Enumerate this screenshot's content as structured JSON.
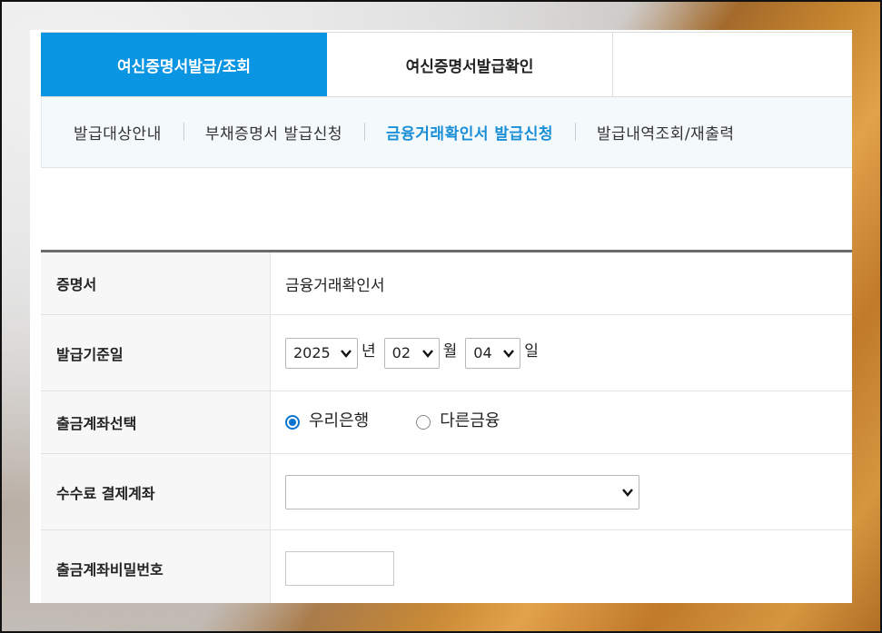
{
  "tabs": [
    {
      "label": "여신증명서발급/조회",
      "active": true
    },
    {
      "label": "여신증명서발급확인",
      "active": false
    }
  ],
  "subnav": [
    {
      "label": "발급대상안내"
    },
    {
      "label": "부채증명서 발급신청"
    },
    {
      "label": "금융거래확인서 발급신청",
      "active": true
    },
    {
      "label": "발급내역조회/재출력"
    }
  ],
  "form": {
    "certificate": {
      "label": "증명서",
      "value": "금융거래확인서"
    },
    "issue_date": {
      "label": "발급기준일",
      "year": "2025",
      "year_unit": "년",
      "month": "02",
      "month_unit": "월",
      "day": "04",
      "day_unit": "일"
    },
    "withdraw_account": {
      "label": "출금계좌선택",
      "options": [
        {
          "label": "우리은행",
          "selected": true
        },
        {
          "label": "다른금융",
          "selected": false
        }
      ]
    },
    "fee_account": {
      "label": "수수료 결제계좌",
      "value": ""
    },
    "account_password": {
      "label": "출금계좌비밀번호",
      "value": ""
    }
  },
  "colors": {
    "accent": "#0a95e3",
    "active_link": "#1a8fd6",
    "radio": "#0a74d0"
  }
}
